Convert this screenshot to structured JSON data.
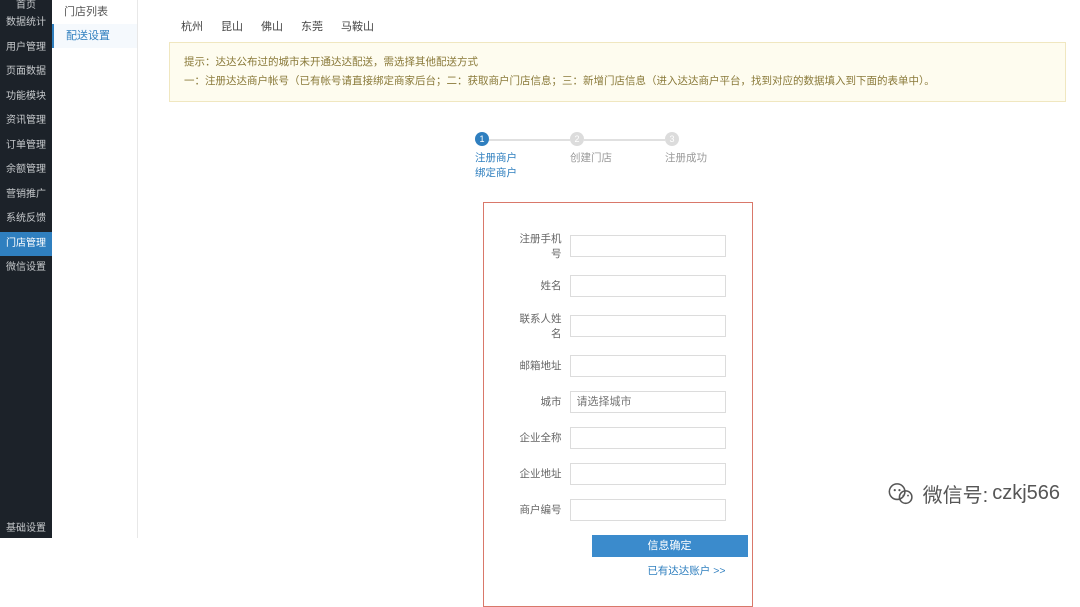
{
  "leftNav": {
    "top": "首页",
    "items": [
      "数据统计",
      "用户管理",
      "页面数据",
      "功能模块",
      "资讯管理",
      "订单管理",
      "余额管理",
      "营销推广",
      "系统反馈",
      "门店管理",
      "微信设置"
    ],
    "activeIndex": 9,
    "bottom": "基础设置"
  },
  "subNav": {
    "items": [
      "门店列表",
      "配送设置"
    ],
    "activeIndex": 1
  },
  "cities": [
    "杭州",
    "昆山",
    "佛山",
    "东莞",
    "马鞍山"
  ],
  "tip": {
    "line1": "提示：达达公布过的城市未开通达达配送，需选择其他配送方式",
    "line2": "一：注册达达商户帐号（已有帐号请直接绑定商家后台；二：获取商户门店信息；三：新增门店信息（进入达达商户平台，找到对应的数据填入到下面的表单中）。"
  },
  "steps": [
    {
      "num": "1",
      "title": "注册商户",
      "sub": "绑定商户"
    },
    {
      "num": "2",
      "title": "创建门店",
      "sub": ""
    },
    {
      "num": "3",
      "title": "注册成功",
      "sub": ""
    }
  ],
  "form": {
    "fields": [
      {
        "label": "注册手机号",
        "value": ""
      },
      {
        "label": "姓名",
        "value": ""
      },
      {
        "label": "联系人姓名",
        "value": ""
      },
      {
        "label": "邮箱地址",
        "value": ""
      },
      {
        "label": "城市",
        "value": "",
        "placeholder": "请选择城市",
        "select": true
      },
      {
        "label": "企业全称",
        "value": ""
      },
      {
        "label": "企业地址",
        "value": ""
      },
      {
        "label": "商户编号",
        "value": ""
      }
    ],
    "submit": "信息确定",
    "link": "已有达达账户 >>"
  },
  "watermark": {
    "prefix": "微信号:",
    "id": "czkj566"
  }
}
